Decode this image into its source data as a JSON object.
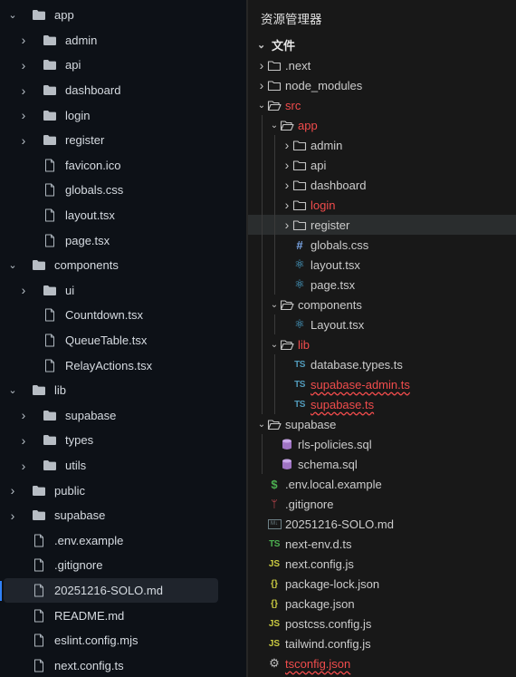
{
  "left_tree": [
    {
      "label": "app",
      "type": "folder",
      "expanded": true,
      "depth": 0
    },
    {
      "label": "admin",
      "type": "folder",
      "expanded": false,
      "depth": 1
    },
    {
      "label": "api",
      "type": "folder",
      "expanded": false,
      "depth": 1
    },
    {
      "label": "dashboard",
      "type": "folder",
      "expanded": false,
      "depth": 1
    },
    {
      "label": "login",
      "type": "folder",
      "expanded": false,
      "depth": 1
    },
    {
      "label": "register",
      "type": "folder",
      "expanded": false,
      "depth": 1
    },
    {
      "label": "favicon.ico",
      "type": "file",
      "depth": 1
    },
    {
      "label": "globals.css",
      "type": "file",
      "depth": 1
    },
    {
      "label": "layout.tsx",
      "type": "file",
      "depth": 1
    },
    {
      "label": "page.tsx",
      "type": "file",
      "depth": 1
    },
    {
      "label": "components",
      "type": "folder",
      "expanded": true,
      "depth": 0
    },
    {
      "label": "ui",
      "type": "folder",
      "expanded": false,
      "depth": 1
    },
    {
      "label": "Countdown.tsx",
      "type": "file",
      "depth": 1
    },
    {
      "label": "QueueTable.tsx",
      "type": "file",
      "depth": 1
    },
    {
      "label": "RelayActions.tsx",
      "type": "file",
      "depth": 1
    },
    {
      "label": "lib",
      "type": "folder",
      "expanded": true,
      "depth": 0
    },
    {
      "label": "supabase",
      "type": "folder",
      "expanded": false,
      "depth": 1
    },
    {
      "label": "types",
      "type": "folder",
      "expanded": false,
      "depth": 1
    },
    {
      "label": "utils",
      "type": "folder",
      "expanded": false,
      "depth": 1
    },
    {
      "label": "public",
      "type": "folder",
      "expanded": false,
      "depth": 0
    },
    {
      "label": "supabase",
      "type": "folder",
      "expanded": false,
      "depth": 0
    },
    {
      "label": ".env.example",
      "type": "file",
      "depth": 0
    },
    {
      "label": ".gitignore",
      "type": "file",
      "depth": 0
    },
    {
      "label": "20251216-SOLO.md",
      "type": "file",
      "depth": 0,
      "selected": true
    },
    {
      "label": "README.md",
      "type": "file",
      "depth": 0
    },
    {
      "label": "eslint.config.mjs",
      "type": "file",
      "depth": 0
    },
    {
      "label": "next.config.ts",
      "type": "file",
      "depth": 0
    }
  ],
  "right_panel": {
    "title": "资源管理器",
    "section": "文件",
    "colors": {
      "error": "#f14c4c",
      "ts": "#519aba",
      "js": "#cbcb41",
      "hover": "#2a2d2e"
    },
    "tree": [
      {
        "label": ".next",
        "type": "folder",
        "expanded": false,
        "depth": 0
      },
      {
        "label": "node_modules",
        "type": "folder",
        "expanded": false,
        "depth": 0
      },
      {
        "label": "src",
        "type": "folder",
        "expanded": true,
        "depth": 0,
        "error": true
      },
      {
        "label": "app",
        "type": "folder",
        "expanded": true,
        "depth": 1,
        "error": true
      },
      {
        "label": "admin",
        "type": "folder",
        "expanded": false,
        "depth": 2
      },
      {
        "label": "api",
        "type": "folder",
        "expanded": false,
        "depth": 2
      },
      {
        "label": "dashboard",
        "type": "folder",
        "expanded": false,
        "depth": 2
      },
      {
        "label": "login",
        "type": "folder",
        "expanded": false,
        "depth": 2,
        "error": true
      },
      {
        "label": "register",
        "type": "folder",
        "expanded": false,
        "depth": 2,
        "hover": true
      },
      {
        "label": "globals.css",
        "type": "file",
        "icon": "css-hash-icon",
        "depth": 2
      },
      {
        "label": "layout.tsx",
        "type": "file",
        "icon": "react-icon",
        "depth": 2
      },
      {
        "label": "page.tsx",
        "type": "file",
        "icon": "react-icon",
        "depth": 2
      },
      {
        "label": "components",
        "type": "folder",
        "expanded": true,
        "depth": 1
      },
      {
        "label": "Layout.tsx",
        "type": "file",
        "icon": "react-icon",
        "depth": 2
      },
      {
        "label": "lib",
        "type": "folder",
        "expanded": true,
        "depth": 1,
        "error": true
      },
      {
        "label": "database.types.ts",
        "type": "file",
        "icon": "ts-icon",
        "depth": 2
      },
      {
        "label": "supabase-admin.ts",
        "type": "file",
        "icon": "ts-icon",
        "depth": 2,
        "error": true,
        "squiggle": true
      },
      {
        "label": "supabase.ts",
        "type": "file",
        "icon": "ts-icon",
        "depth": 2,
        "error": true,
        "squiggle": true
      },
      {
        "label": "supabase",
        "type": "folder",
        "expanded": true,
        "depth": 0
      },
      {
        "label": "rls-policies.sql",
        "type": "file",
        "icon": "database-icon",
        "depth": 1
      },
      {
        "label": "schema.sql",
        "type": "file",
        "icon": "database-icon",
        "depth": 1
      },
      {
        "label": ".env.local.example",
        "type": "file",
        "icon": "dollar-icon",
        "depth": 0
      },
      {
        "label": ".gitignore",
        "type": "file",
        "icon": "git-icon",
        "depth": 0
      },
      {
        "label": "20251216-SOLO.md",
        "type": "file",
        "icon": "markdown-icon",
        "depth": 0
      },
      {
        "label": "next-env.d.ts",
        "type": "file",
        "icon": "ts-green-icon",
        "depth": 0
      },
      {
        "label": "next.config.js",
        "type": "file",
        "icon": "js-icon",
        "depth": 0
      },
      {
        "label": "package-lock.json",
        "type": "file",
        "icon": "json-icon",
        "depth": 0
      },
      {
        "label": "package.json",
        "type": "file",
        "icon": "json-icon",
        "depth": 0
      },
      {
        "label": "postcss.config.js",
        "type": "file",
        "icon": "js-icon",
        "depth": 0
      },
      {
        "label": "tailwind.config.js",
        "type": "file",
        "icon": "js-icon",
        "depth": 0
      },
      {
        "label": "tsconfig.json",
        "type": "file",
        "icon": "gear-icon",
        "depth": 0,
        "error": true,
        "squiggle": true
      }
    ]
  }
}
